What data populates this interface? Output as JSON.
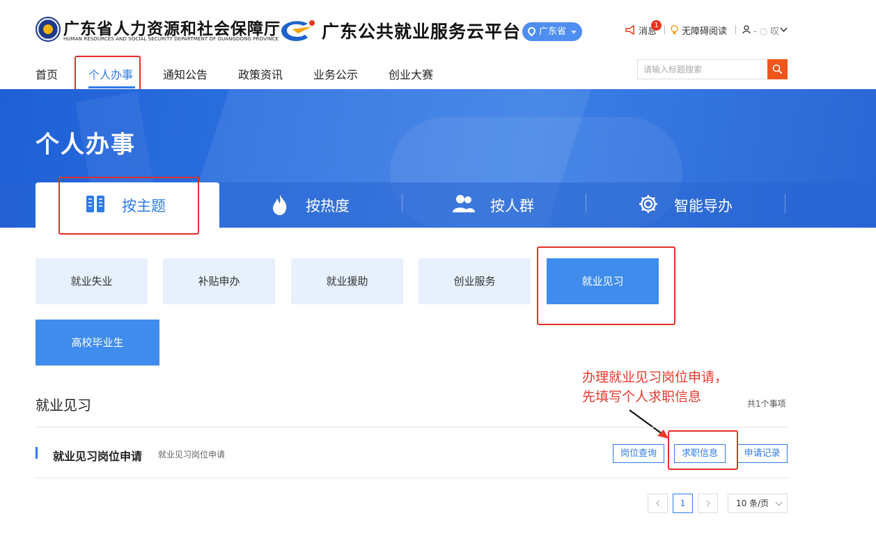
{
  "header": {
    "dept_name_cn": "广东省人力资源和社会保障厅",
    "dept_name_en": "HUMAN RESOURCES AND SOCIAL SECURITY DEPARTMENT OF GUANGDONG PROVINCE",
    "platform_name": "广东公共就业服务云平台",
    "region": "广东省",
    "messages_label": "消息",
    "messages_count": "1",
    "accessibility_label": "无障碍阅读",
    "user_name": "- ◌ 叹",
    "icons": {
      "emblem": "provincial-emblem-icon",
      "platform": "platform-logo-icon",
      "location": "location-pin-icon",
      "message": "megaphone-icon",
      "accessibility": "lightbulb-icon",
      "user": "user-icon"
    },
    "colors": {
      "accent": "#2f7be8",
      "search": "#f0561c",
      "annotation": "#e53a2d"
    }
  },
  "nav": {
    "items": [
      {
        "label": "首页"
      },
      {
        "label": "个人办事"
      },
      {
        "label": "通知公告"
      },
      {
        "label": "政策资讯"
      },
      {
        "label": "业务公示"
      },
      {
        "label": "创业大赛"
      }
    ],
    "active": "个人办事"
  },
  "search": {
    "placeholder": "请输入标题搜索"
  },
  "banner": {
    "title": "个人办事",
    "tabs": [
      {
        "label": "按主题",
        "icon": "book-icon"
      },
      {
        "label": "按热度",
        "icon": "flame-icon"
      },
      {
        "label": "按人群",
        "icon": "people-icon"
      },
      {
        "label": "智能导办",
        "icon": "gear-icon"
      }
    ],
    "active_tab": "按主题"
  },
  "categories": [
    {
      "label": "就业失业"
    },
    {
      "label": "补贴申办"
    },
    {
      "label": "就业援助"
    },
    {
      "label": "创业服务"
    },
    {
      "label": "就业见习"
    },
    {
      "label": "高校毕业生"
    }
  ],
  "section": {
    "title": "就业见习",
    "count": "共1个事项",
    "items": [
      {
        "title": "就业见习岗位申请",
        "subtitle": "就业见习岗位申请",
        "actions": [
          {
            "label": "岗位查询"
          },
          {
            "label": "求职信息"
          },
          {
            "label": "申请记录"
          }
        ]
      }
    ]
  },
  "annotation": {
    "line1": "办理就业见习岗位申请，",
    "line2": "先填写个人求职信息"
  },
  "pagination": {
    "current": "1",
    "page_size": "10 条/页"
  }
}
